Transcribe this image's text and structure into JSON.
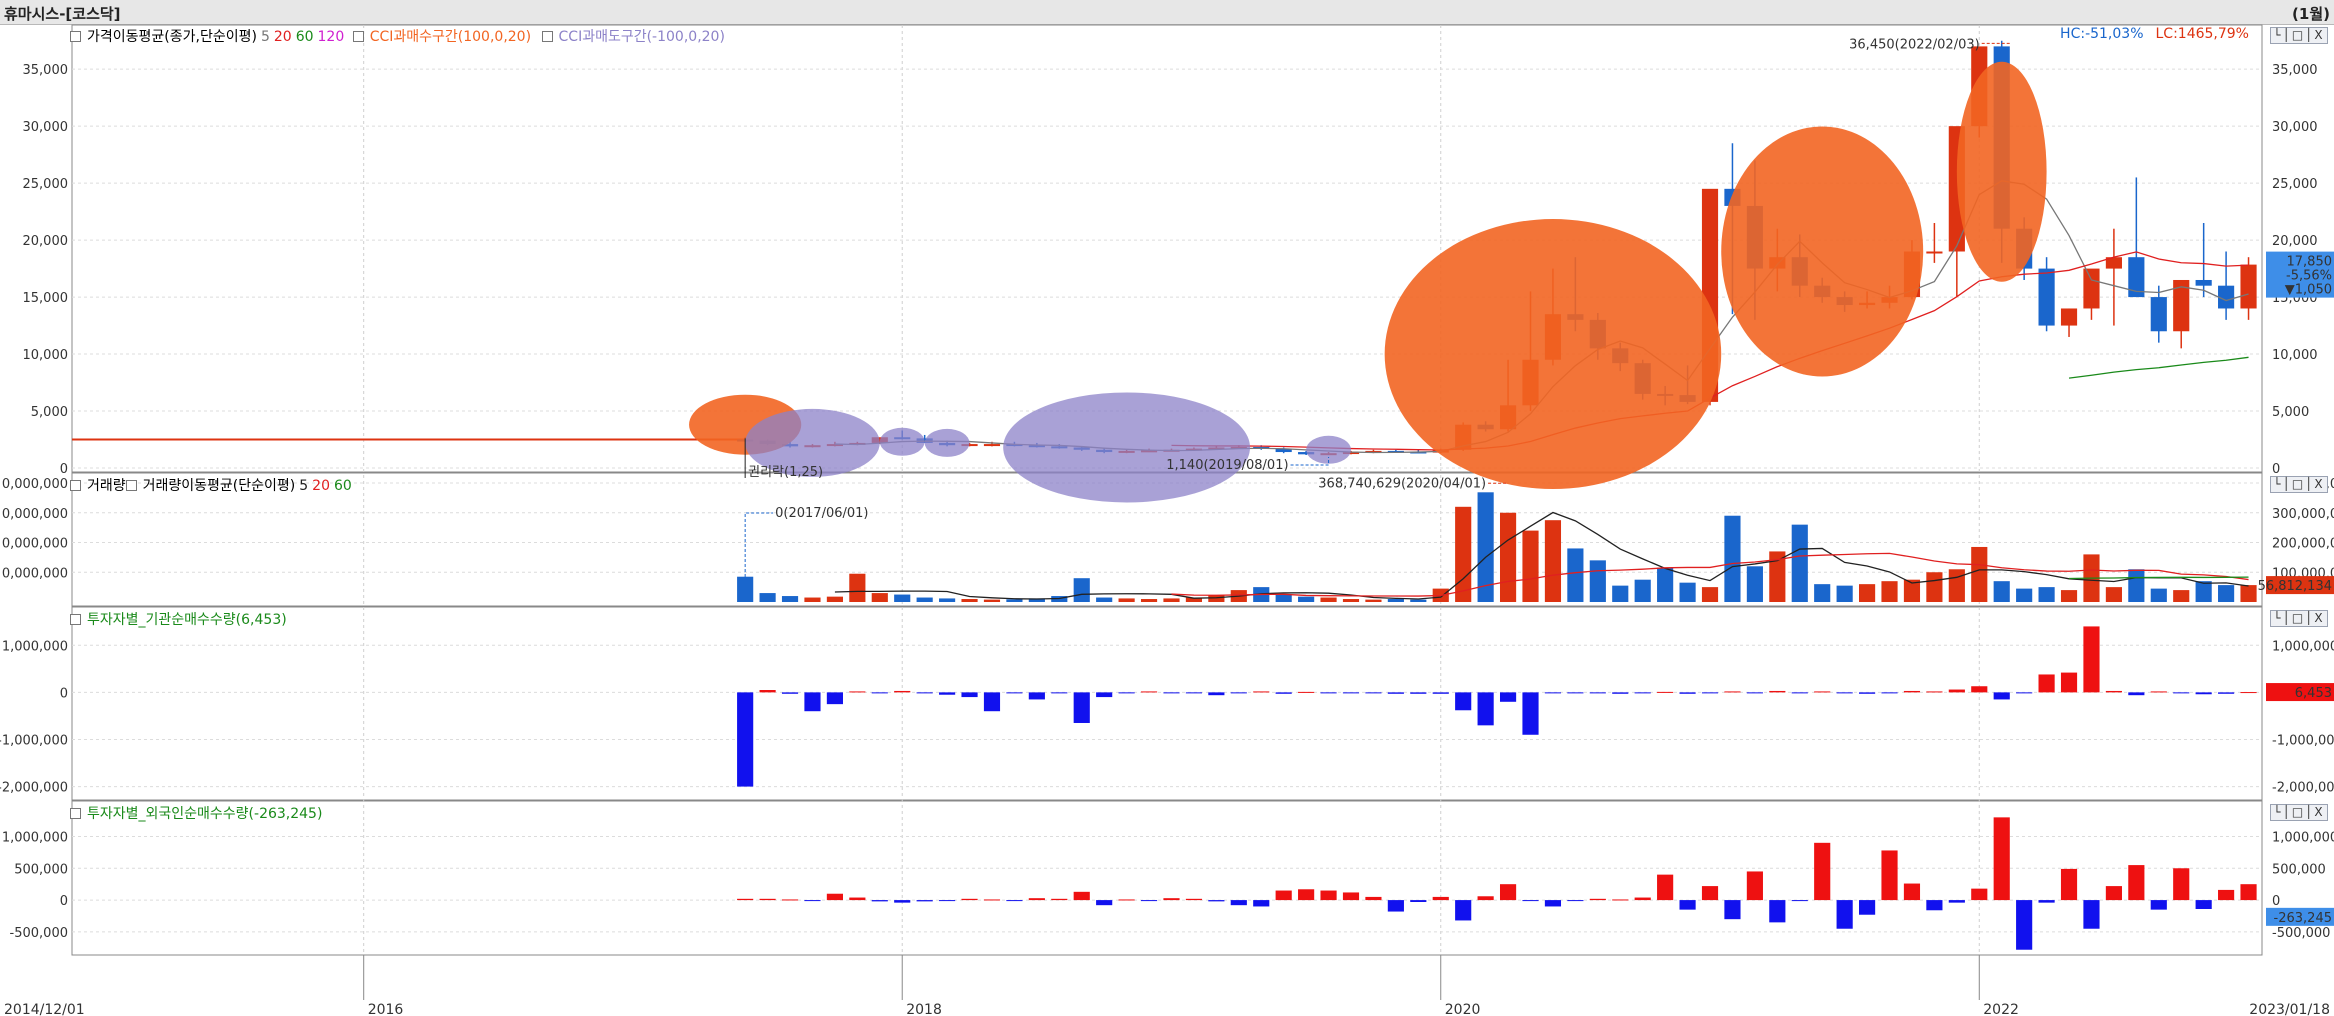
{
  "window": {
    "title": "휴마시스-[코스닥]",
    "period": "(1월)"
  },
  "panels": {
    "price": {
      "legend_title": "가격이동평균(종가,단순이평)",
      "ma": [
        {
          "label": "5",
          "color": "#777777"
        },
        {
          "label": "20",
          "color": "#e02020"
        },
        {
          "label": "60",
          "color": "#1a8a1a"
        },
        {
          "label": "120",
          "color": "#d020d0"
        }
      ],
      "cci_buy": "CCI과매수구간(100,0,20)",
      "cci_sell": "CCI과매도구간(-100,0,20)",
      "hc_text": "HC:-51,03%",
      "lc_text": "LC:1465,79%",
      "y_ticks": [
        "0",
        "5,000",
        "10,000",
        "15,000",
        "20,000",
        "25,000",
        "30,000",
        "35,000"
      ],
      "current_price": "17,850",
      "change_pct": "-5,56%",
      "change_abs": "▼1,050",
      "annotations": {
        "max": "36,450(2022/02/03)",
        "min": "1,140(2019/08/01)",
        "rights": "권리락(1,25)"
      }
    },
    "volume": {
      "legend_title": "거래량",
      "legend_title2": "거래량이동평균(단순이평)",
      "ma": [
        {
          "label": "5",
          "color": "#222222"
        },
        {
          "label": "20",
          "color": "#e02020"
        },
        {
          "label": "60",
          "color": "#1a8a1a"
        }
      ],
      "y_ticks": [
        "100,000,000",
        "200,000,000",
        "300,000,000",
        "400,000,000"
      ],
      "current": "56,812,134",
      "annotations": {
        "max": "368,740,629(2020/04/01)",
        "min": "0(2017/06/01)"
      }
    },
    "institution": {
      "legend_title": "투자자별_기관순매수수량(6,453)",
      "y_ticks": [
        "-2,000,000",
        "-1,000,000",
        "0",
        "1,000,000"
      ],
      "current": "6,453"
    },
    "foreign": {
      "legend_title": "투자자별_외국인순매수수량(-263,245)",
      "y_ticks": [
        "-500,000",
        "0",
        "500,000",
        "1,000,000"
      ],
      "current": "-263,245"
    }
  },
  "panel_buttons": "└│□│X",
  "x_axis": {
    "start": "2014/12/01",
    "end": "2023/01/18",
    "ticks": [
      "2016",
      "2018",
      "2020",
      "2022"
    ]
  },
  "colors": {
    "up": "#dd3311",
    "down": "#1a66cc",
    "inst_pos": "#ee1111",
    "inst_neg": "#1111ee",
    "circle_orange": "#f26522",
    "circle_purple": "#8c82c8"
  },
  "chart_data": {
    "type": "candlestick",
    "price_ylim": [
      0,
      38000
    ],
    "volume_ylim": [
      0,
      400000000
    ],
    "institution_ylim": [
      -2200000,
      1600000
    ],
    "foreign_ylim": [
      -800000,
      1400000
    ],
    "early_period": {
      "from": "2014/12",
      "to": "2017/05",
      "price_approx": 2500
    },
    "series": [
      {
        "name": "monthly",
        "x": [
          "2017/06",
          "2017/07",
          "2017/08",
          "2017/09",
          "2017/10",
          "2017/11",
          "2017/12",
          "2018/01",
          "2018/02",
          "2018/03",
          "2018/04",
          "2018/05",
          "2018/06",
          "2018/07",
          "2018/08",
          "2018/09",
          "2018/10",
          "2018/11",
          "2018/12",
          "2019/01",
          "2019/02",
          "2019/03",
          "2019/04",
          "2019/05",
          "2019/06",
          "2019/07",
          "2019/08",
          "2019/09",
          "2019/10",
          "2019/11",
          "2019/12",
          "2020/01",
          "2020/02",
          "2020/03",
          "2020/04",
          "2020/05",
          "2020/06",
          "2020/07",
          "2020/08",
          "2020/09",
          "2020/10",
          "2020/11",
          "2020/12",
          "2021/01",
          "2021/02",
          "2021/03",
          "2021/04",
          "2021/05",
          "2021/06",
          "2021/07",
          "2021/08",
          "2021/09",
          "2021/10",
          "2021/11",
          "2021/12",
          "2022/01",
          "2022/02",
          "2022/03",
          "2022/04",
          "2022/05",
          "2022/06",
          "2022/07",
          "2022/08",
          "2022/09",
          "2022/10",
          "2022/11",
          "2022/12",
          "2023/01"
        ],
        "open": [
          2500,
          2400,
          2100,
          1900,
          2000,
          2100,
          2200,
          2700,
          2600,
          2200,
          2000,
          2100,
          2100,
          2000,
          1900,
          1800,
          1600,
          1400,
          1500,
          1550,
          1600,
          1700,
          1800,
          1850,
          1700,
          1400,
          1200,
          1300,
          1400,
          1500,
          1450,
          1350,
          1600,
          3800,
          3400,
          5500,
          9500,
          13500,
          13000,
          10500,
          9200,
          6500,
          6400,
          5800,
          24500,
          23000,
          17500,
          18500,
          16000,
          15000,
          14300,
          14500,
          15000,
          19000,
          19000,
          30000,
          37000,
          21000,
          17500,
          12500,
          14000,
          17500,
          18500,
          15000,
          12000,
          16500,
          16000,
          14000
        ],
        "high": [
          2700,
          2500,
          2300,
          2100,
          2300,
          2300,
          2600,
          3300,
          2900,
          2400,
          2200,
          2300,
          2300,
          2200,
          2100,
          1900,
          1800,
          1600,
          1700,
          1700,
          1800,
          1900,
          2000,
          2000,
          1800,
          1500,
          1400,
          1500,
          1600,
          1600,
          1600,
          1700,
          4000,
          4100,
          9500,
          15500,
          17500,
          18500,
          13600,
          11000,
          9500,
          7200,
          9000,
          13000,
          28500,
          27000,
          21000,
          20500,
          16700,
          15500,
          15500,
          16000,
          20000,
          21500,
          20000,
          36450,
          37500,
          22000,
          18500,
          14000,
          16500,
          21000,
          25500,
          16000,
          15500,
          21500,
          19000,
          18500
        ],
        "low": [
          2300,
          2000,
          1800,
          1800,
          1900,
          2000,
          2100,
          2500,
          2200,
          1900,
          1900,
          1900,
          1900,
          1800,
          1700,
          1500,
          1300,
          1300,
          1400,
          1450,
          1500,
          1600,
          1700,
          1600,
          1300,
          1140,
          1150,
          1200,
          1300,
          1350,
          1300,
          1300,
          1500,
          3200,
          3200,
          5000,
          9000,
          12000,
          9500,
          8500,
          6000,
          5500,
          5600,
          5500,
          13500,
          13000,
          15500,
          15000,
          14500,
          13700,
          14000,
          14000,
          14800,
          18000,
          15000,
          29000,
          18000,
          16500,
          12000,
          11500,
          13000,
          12500,
          15500,
          11000,
          10500,
          15000,
          13000,
          13000
        ],
        "close": [
          2400,
          2100,
          1900,
          2000,
          2100,
          2200,
          2700,
          2600,
          2200,
          2000,
          2100,
          2100,
          2000,
          1900,
          1800,
          1600,
          1400,
          1500,
          1550,
          1600,
          1700,
          1800,
          1850,
          1700,
          1400,
          1200,
          1300,
          1400,
          1500,
          1450,
          1350,
          1600,
          3800,
          3400,
          5500,
          9500,
          13500,
          13000,
          10500,
          9200,
          6500,
          6400,
          5800,
          24500,
          23000,
          17500,
          18500,
          16000,
          15000,
          14300,
          14500,
          15000,
          19000,
          19000,
          30000,
          37000,
          21000,
          17500,
          12500,
          14000,
          17500,
          18500,
          15000,
          12000,
          16500,
          16000,
          14000,
          17850
        ],
        "volume": [
          85000000,
          30000000,
          20000000,
          15000000,
          18000000,
          95000000,
          30000000,
          25000000,
          15000000,
          12000000,
          10000000,
          8000000,
          9000000,
          12000000,
          20000000,
          80000000,
          15000000,
          12000000,
          10000000,
          12000000,
          15000000,
          22000000,
          40000000,
          50000000,
          25000000,
          18000000,
          15000000,
          10000000,
          8000000,
          10000000,
          8000000,
          45000000,
          320000000,
          368740629,
          300000000,
          240000000,
          275000000,
          180000000,
          140000000,
          55000000,
          75000000,
          115000000,
          65000000,
          50000000,
          290000000,
          120000000,
          170000000,
          260000000,
          60000000,
          55000000,
          60000000,
          70000000,
          75000000,
          100000000,
          110000000,
          185000000,
          70000000,
          45000000,
          50000000,
          40000000,
          160000000,
          50000000,
          110000000,
          45000000,
          40000000,
          70000000,
          56812134,
          56812134
        ],
        "institution": [
          -2000000,
          50000,
          -30000,
          -400000,
          -250000,
          20000,
          -20000,
          30000,
          -10000,
          -50000,
          -100000,
          -400000,
          -20000,
          -150000,
          -10000,
          -650000,
          -100000,
          -10000,
          20000,
          -20000,
          -10000,
          -60000,
          -20000,
          20000,
          -30000,
          10000,
          -20000,
          -20000,
          -10000,
          -30000,
          -30000,
          -30000,
          -380000,
          -700000,
          -200000,
          -900000,
          -20000,
          -20000,
          -20000,
          -30000,
          -20000,
          10000,
          -30000,
          -10000,
          20000,
          -20000,
          30000,
          -20000,
          20000,
          -20000,
          -30000,
          -10000,
          30000,
          20000,
          60000,
          130000,
          -150000,
          -10000,
          380000,
          420000,
          1400000,
          30000,
          -60000,
          20000,
          -20000,
          -40000,
          -30000,
          6453
        ],
        "foreign": [
          20000,
          20000,
          10000,
          -10000,
          100000,
          40000,
          -20000,
          -40000,
          -20000,
          -10000,
          20000,
          10000,
          -10000,
          30000,
          20000,
          130000,
          -80000,
          10000,
          -10000,
          30000,
          20000,
          -20000,
          -80000,
          -100000,
          150000,
          170000,
          150000,
          120000,
          50000,
          -180000,
          -30000,
          50000,
          -320000,
          60000,
          250000,
          -10000,
          -100000,
          -10000,
          20000,
          10000,
          40000,
          400000,
          -150000,
          220000,
          -300000,
          450000,
          -350000,
          -10000,
          900000,
          -450000,
          -230000,
          780000,
          260000,
          -160000,
          -40000,
          180000,
          1300000,
          -780000,
          -40000,
          490000,
          -450000,
          220000,
          550000,
          -150000,
          500000,
          -140000,
          160000,
          250000,
          -263245
        ]
      }
    ]
  }
}
